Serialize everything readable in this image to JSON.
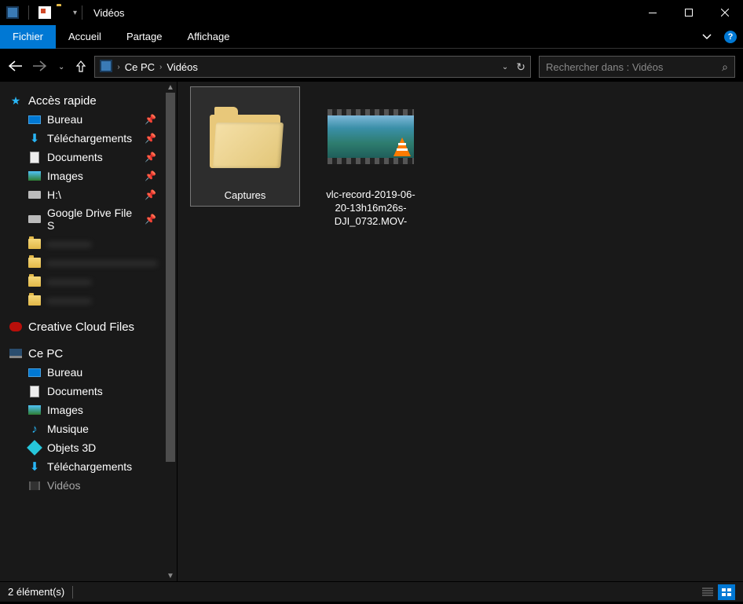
{
  "window": {
    "title": "Vidéos"
  },
  "ribbon": {
    "file": "Fichier",
    "tabs": [
      "Accueil",
      "Partage",
      "Affichage"
    ]
  },
  "breadcrumb": {
    "root": "Ce PC",
    "current": "Vidéos"
  },
  "search": {
    "placeholder": "Rechercher dans : Vidéos"
  },
  "sidebar": {
    "quick_access": "Accès rapide",
    "pinned": [
      {
        "label": "Bureau",
        "icon": "desktop"
      },
      {
        "label": "Téléchargements",
        "icon": "download"
      },
      {
        "label": "Documents",
        "icon": "doc"
      },
      {
        "label": "Images",
        "icon": "image"
      },
      {
        "label": "H:\\",
        "icon": "drive"
      },
      {
        "label": "Google Drive File S",
        "icon": "drive"
      }
    ],
    "recent_blur": [
      "————",
      "——————————",
      "————",
      "————"
    ],
    "creative_cloud": "Creative Cloud Files",
    "this_pc": "Ce PC",
    "pc_items": [
      {
        "label": "Bureau",
        "icon": "desktop"
      },
      {
        "label": "Documents",
        "icon": "doc"
      },
      {
        "label": "Images",
        "icon": "image"
      },
      {
        "label": "Musique",
        "icon": "music"
      },
      {
        "label": "Objets 3D",
        "icon": "3d"
      },
      {
        "label": "Téléchargements",
        "icon": "download"
      },
      {
        "label": "Vidéos",
        "icon": "video"
      }
    ]
  },
  "items": [
    {
      "type": "folder",
      "label": "Captures",
      "selected": true
    },
    {
      "type": "video",
      "label": "vlc-record-2019-06-20-13h16m26s-DJI_0732.MOV-",
      "selected": false
    }
  ],
  "status": {
    "count": "2 élément(s)"
  }
}
